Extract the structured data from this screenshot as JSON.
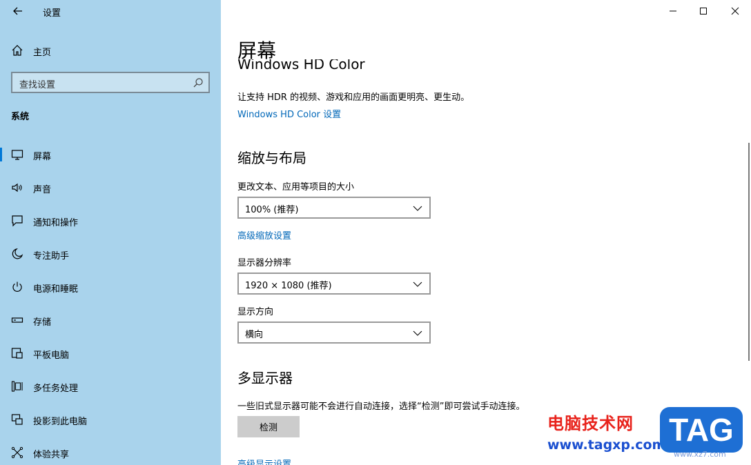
{
  "window": {
    "title": "设置"
  },
  "sidebar": {
    "home_label": "主页",
    "search_placeholder": "查找设置",
    "section_title": "系统",
    "items": [
      {
        "label": "屏幕",
        "icon": "monitor-icon",
        "active": true
      },
      {
        "label": "声音",
        "icon": "speaker-icon"
      },
      {
        "label": "通知和操作",
        "icon": "notification-icon"
      },
      {
        "label": "专注助手",
        "icon": "moon-icon"
      },
      {
        "label": "电源和睡眠",
        "icon": "power-icon"
      },
      {
        "label": "存储",
        "icon": "storage-icon"
      },
      {
        "label": "平板电脑",
        "icon": "tablet-icon"
      },
      {
        "label": "多任务处理",
        "icon": "multitask-icon"
      },
      {
        "label": "投影到此电脑",
        "icon": "project-icon"
      },
      {
        "label": "体验共享",
        "icon": "share-icon"
      }
    ]
  },
  "main": {
    "page_title": "屏幕",
    "hdr_heading": "Windows HD Color",
    "hdr_desc": "让支持 HDR 的视频、游戏和应用的画面更明亮、更生动。",
    "hdr_link": "Windows HD Color 设置",
    "scale_heading": "缩放与布局",
    "scale_label": "更改文本、应用等项目的大小",
    "scale_value": "100% (推荐)",
    "advanced_scale_link": "高级缩放设置",
    "resolution_label": "显示器分辨率",
    "resolution_value": "1920 × 1080 (推荐)",
    "orientation_label": "显示方向",
    "orientation_value": "横向",
    "multi_heading": "多显示器",
    "multi_desc": "一些旧式显示器可能不会进行自动连接，选择“检测”即可尝试手动连接。",
    "detect_button": "检测",
    "advanced_display_link": "高级显示设置"
  },
  "watermark": {
    "brand": "电脑技术网",
    "url": "www.tagxp.com",
    "logo": "TAG",
    "site": "www.xz7.com"
  },
  "colors": {
    "sidebar_bg": "#a9d3ec",
    "accent": "#0078d7",
    "link": "#0067b8"
  }
}
